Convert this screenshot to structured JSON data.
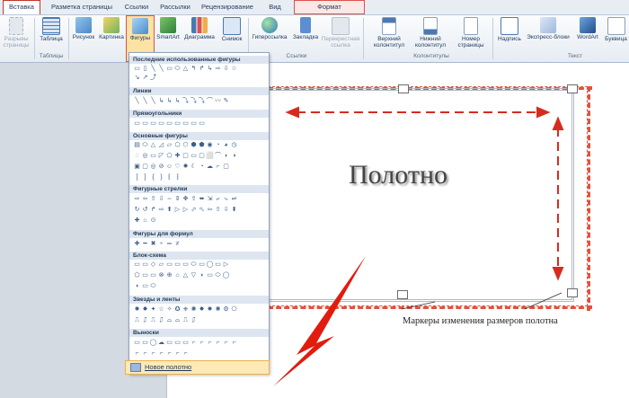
{
  "tabs": [
    "Вставка",
    "Разметка страницы",
    "Ссылки",
    "Рассылки",
    "Рецензирование",
    "Вид",
    "Формат"
  ],
  "ribbon": {
    "buttons": {
      "breaks": "Разрывы страницы",
      "table": "Таблица",
      "picture": "Рисунок",
      "clipart": "Картинка",
      "shapes": "Фигуры",
      "smartart": "SmartArt",
      "chart": "Диаграмма",
      "screenshot": "Снимок",
      "hyperlink": "Гиперссылка",
      "bookmark": "Закладка",
      "crossref": "Перекрестная ссылка",
      "header": "Верхний колонтитул",
      "footer": "Нижний колонтитул",
      "pagenum": "Номер страницы",
      "textbox": "Надпись",
      "quickparts": "Экспресс-блоки",
      "wordart": "WordArt",
      "dropcap": "Буквица"
    },
    "groups": {
      "tables": "Таблицы",
      "links": "Ссылки",
      "headerfooter": "Колонтитулы",
      "text": "Текст"
    }
  },
  "gallery": {
    "sections": [
      {
        "title": "Последние использованные фигуры",
        "rows": [
          "▭▯╲╲▭⬭△↰↱↳⇨⇩☆",
          "↘↗⤴"
        ]
      },
      {
        "title": "Линии",
        "rows": [
          "╲╲╲↳↳↳⤵⤵⤵⌒〰✎"
        ]
      },
      {
        "title": "Прямоугольники",
        "rows": [
          "▭▭▭▭▭▭▭▭▭"
        ]
      },
      {
        "title": "Основные фигуры",
        "rows": [
          "▤⬭△◿▱⬠⬡⬢⬟◉◔◕◷",
          "◌◎▭◸⬠✚▢▭▢⬜⌒◗◑",
          "▣▢◎⊘☺♡✹☾◔☁⌐▢",
          "[ ] { } ⁅ ⁆"
        ]
      },
      {
        "title": "Фигурные стрелки",
        "rows": [
          "⇨⇦⇧⇩⇔⇕✥⇪⬌⇲⤶⤷⇌",
          "↻↺↱⇨⬆▷▷⬀⬁⇦⇧⇩⬍",
          "✚⌂⊙"
        ]
      },
      {
        "title": "Фигуры для формул",
        "rows": [
          "✚━✖÷═≠"
        ]
      },
      {
        "title": "Блок-схема",
        "rows": [
          "▭▭◇▱▭▭▭⬭▭◯▭▷",
          "⬠▭▭⊗⊕⌂△▽◖▭⬭◯",
          "◖▭⬭"
        ]
      },
      {
        "title": "Звезды и ленты",
        "rows": [
          "✹✸✦☆✧✪⎈✺✸✹✺⚙⎔",
          "⎍⎎⎍⎎⌓⌓⎍⎎"
        ]
      },
      {
        "title": "Выноски",
        "rows": [
          "▭▭◯☁▭▭▭⌐⌐⌐⌐⌐⌐",
          "⌐⌐⌐⌐⌐⌐⌐"
        ]
      }
    ],
    "new_canvas": "Новое полотно"
  },
  "document": {
    "canvas_title": "Полотно",
    "caption": "Маркеры изменения размеров полотна"
  }
}
